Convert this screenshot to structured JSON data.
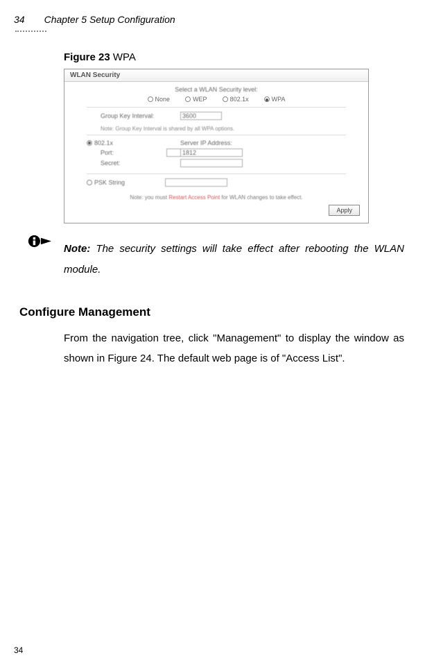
{
  "header": {
    "page_number": "34",
    "chapter_title": "Chapter 5 Setup Configuration"
  },
  "figure": {
    "label_bold": "Figure 23",
    "label_rest": " WPA"
  },
  "screenshot": {
    "titlebar": "WLAN Security",
    "select_level": "Select a WLAN Security level:",
    "radios": {
      "none": "None",
      "wep": "WEP",
      "dot1x": "802.1x",
      "wpa": "WPA"
    },
    "group_key_label": "Group Key Interval:",
    "group_key_value": "3600",
    "group_note": "Note: Group Key Interval is shared by all WPA options.",
    "auth_label": "802.1x",
    "server_ip_label": "Server IP Address:",
    "port_label": "Port:",
    "port_value": "1812",
    "secret_label": "Secret:",
    "psk_label": "PSK String",
    "restart_note_pre": "Note: you must ",
    "restart_note_red": "Restart Access Point",
    "restart_note_post": " for WLAN changes to take effect.",
    "apply_button": "Apply"
  },
  "note": {
    "label": "Note:",
    "text": " The security settings will take effect after rebooting the WLAN module."
  },
  "section_heading": "Configure Management",
  "body_paragraph": "From the navigation tree, click \"Management\" to display the window as shown in Figure 24. The default web page is of \"Access List\".",
  "footer_page": "34"
}
